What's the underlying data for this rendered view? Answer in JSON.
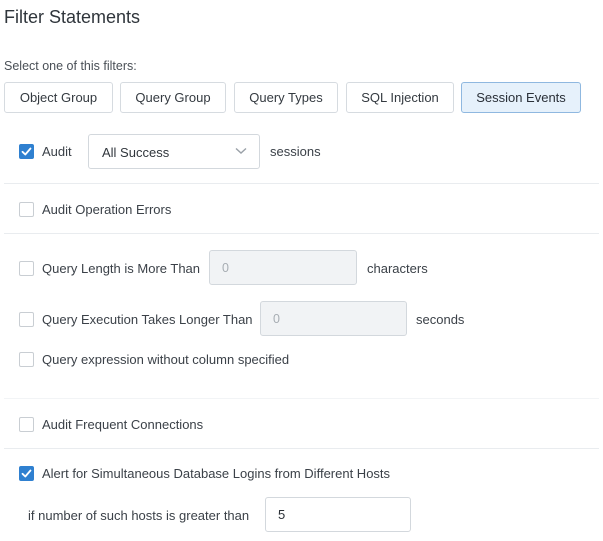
{
  "title": "Filter Statements",
  "hint": "Select one of this filters:",
  "filters": [
    {
      "label": "Object Group",
      "active": false
    },
    {
      "label": "Query Group",
      "active": false
    },
    {
      "label": "Query Types",
      "active": false
    },
    {
      "label": "SQL Injection",
      "active": false
    },
    {
      "label": "Session Events",
      "active": true
    }
  ],
  "audit": {
    "checked": true,
    "label": "Audit",
    "select_value": "All Success",
    "suffix": "sessions"
  },
  "audit_operation_errors": {
    "checked": false,
    "label": "Audit Operation Errors"
  },
  "query_length": {
    "checked": false,
    "label": "Query Length is More Than",
    "value": "0",
    "unit": "characters"
  },
  "query_execution": {
    "checked": false,
    "label": "Query Execution Takes Longer Than",
    "value": "0",
    "unit": "seconds"
  },
  "query_expression": {
    "checked": false,
    "label": "Query expression without column specified"
  },
  "frequent_connections": {
    "checked": false,
    "label": "Audit Frequent Connections"
  },
  "simultaneous_logins": {
    "checked": true,
    "label": "Alert for Simultaneous Database Logins from Different Hosts",
    "hosts_label": "if number of such hosts is greater than",
    "hosts_value": "5"
  },
  "colors": {
    "accent": "#2f80d0",
    "active_tab_bg": "#e6f1fb",
    "active_tab_border": "#8fb8e0"
  }
}
